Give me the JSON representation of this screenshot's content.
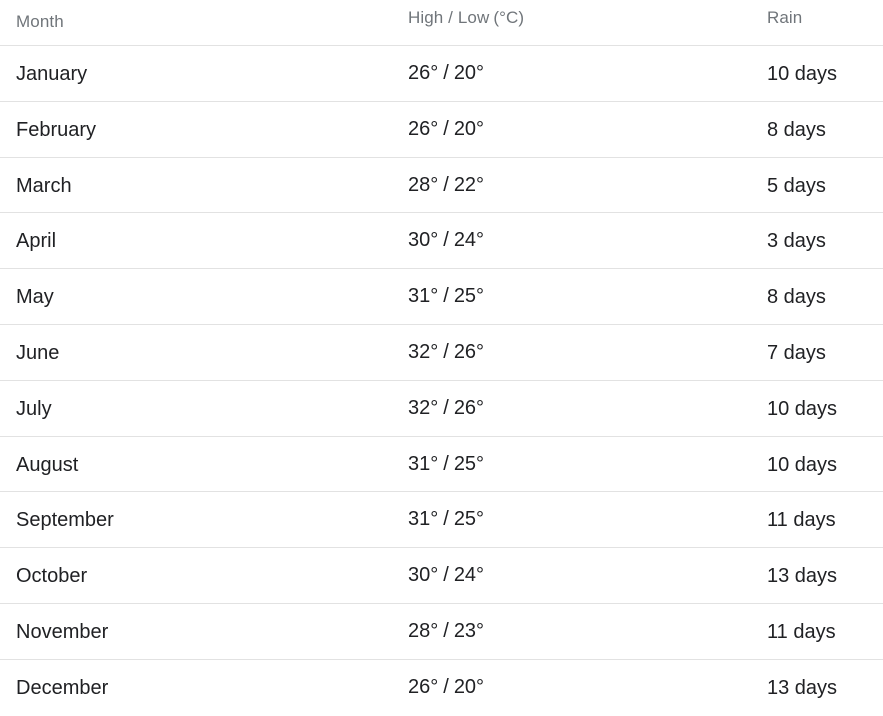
{
  "table": {
    "headers": {
      "month": "Month",
      "high_low": "High / Low",
      "unit": "(°C)",
      "rain": "Rain"
    },
    "rows": [
      {
        "month": "January",
        "high": "26°",
        "low": "20°",
        "rain": "10 days"
      },
      {
        "month": "February",
        "high": "26°",
        "low": "20°",
        "rain": "8 days"
      },
      {
        "month": "March",
        "high": "28°",
        "low": "22°",
        "rain": "5 days"
      },
      {
        "month": "April",
        "high": "30°",
        "low": "24°",
        "rain": "3 days"
      },
      {
        "month": "May",
        "high": "31°",
        "low": "25°",
        "rain": "8 days"
      },
      {
        "month": "June",
        "high": "32°",
        "low": "26°",
        "rain": "7 days"
      },
      {
        "month": "July",
        "high": "32°",
        "low": "26°",
        "rain": "10 days"
      },
      {
        "month": "August",
        "high": "31°",
        "low": "25°",
        "rain": "10 days"
      },
      {
        "month": "September",
        "high": "31°",
        "low": "25°",
        "rain": "11 days"
      },
      {
        "month": "October",
        "high": "30°",
        "low": "24°",
        "rain": "13 days"
      },
      {
        "month": "November",
        "high": "28°",
        "low": "23°",
        "rain": "11 days"
      },
      {
        "month": "December",
        "high": "26°",
        "low": "20°",
        "rain": "13 days"
      }
    ],
    "separator": "/"
  },
  "colors": {
    "header_text": "#70757a",
    "body_text": "#202124",
    "divider": "#e2e2e2",
    "background": "#ffffff"
  }
}
